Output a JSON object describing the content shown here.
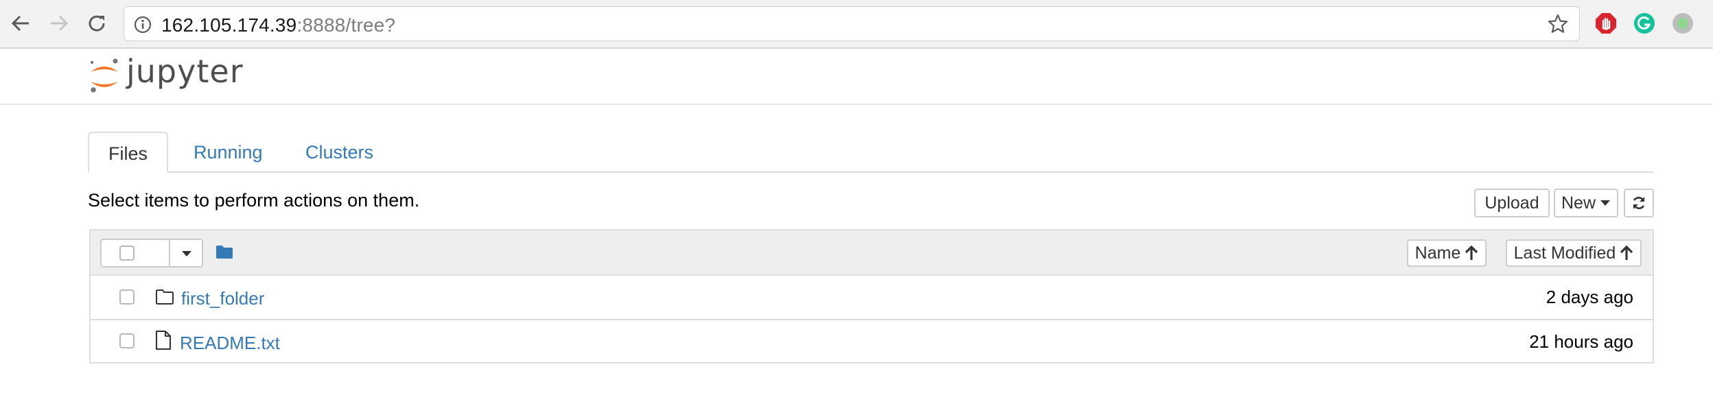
{
  "browser": {
    "url_host": "162.105.174.39",
    "url_rest": ":8888/tree?",
    "extensions": [
      "adblock-icon",
      "grammarly-icon",
      "extension-status-icon"
    ]
  },
  "app": {
    "logo_text": "jupyter"
  },
  "tabs": [
    {
      "label": "Files",
      "active": true
    },
    {
      "label": "Running",
      "active": false
    },
    {
      "label": "Clusters",
      "active": false
    }
  ],
  "hint": "Select items to perform actions on them.",
  "toolbar": {
    "upload_label": "Upload",
    "new_label": "New"
  },
  "list_header": {
    "sort_name_label": "Name",
    "sort_modified_label": "Last Modified"
  },
  "items": [
    {
      "name": "first_folder",
      "type": "folder",
      "modified": "2 days ago"
    },
    {
      "name": "README.txt",
      "type": "file",
      "modified": "21 hours ago"
    }
  ],
  "colors": {
    "link": "#337ab7",
    "jupyter_orange": "#f37726",
    "adblock_red": "#d9262e",
    "grammarly_green": "#15c39a"
  }
}
